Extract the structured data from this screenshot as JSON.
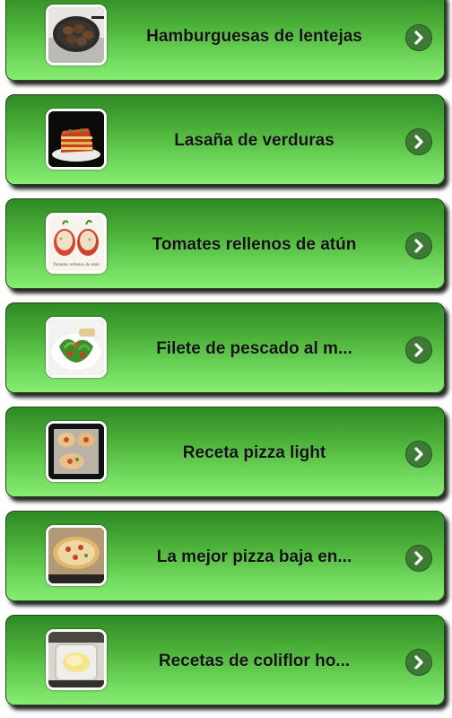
{
  "recipes": [
    {
      "title": "Hamburguesas de lentejas",
      "thumbnail_icon": "lentil-burgers-photo"
    },
    {
      "title": "Lasaña de verduras",
      "thumbnail_icon": "vegetable-lasagna-photo"
    },
    {
      "title": "Tomates rellenos de atún",
      "thumbnail_icon": "stuffed-tomatoes-photo",
      "thumbnail_caption": "Tomates rellenos de atún"
    },
    {
      "title": "Filete de pescado al m...",
      "thumbnail_icon": "fish-fillet-salad-photo"
    },
    {
      "title": "Receta pizza light",
      "thumbnail_icon": "light-pizza-photo"
    },
    {
      "title": "La mejor pizza baja en...",
      "thumbnail_icon": "low-cal-pizza-photo"
    },
    {
      "title": "Recetas de coliflor ho...",
      "thumbnail_icon": "cauliflower-dish-photo"
    }
  ],
  "colors": {
    "card_gradient_top": "#2f8a24",
    "card_gradient_bottom": "#86ec72",
    "arrow_circle": "#3f7a35",
    "arrow_chevron": "#ffffff",
    "title_text": "#121212"
  },
  "icons": {
    "row_arrow": "chevron-right-icon"
  }
}
